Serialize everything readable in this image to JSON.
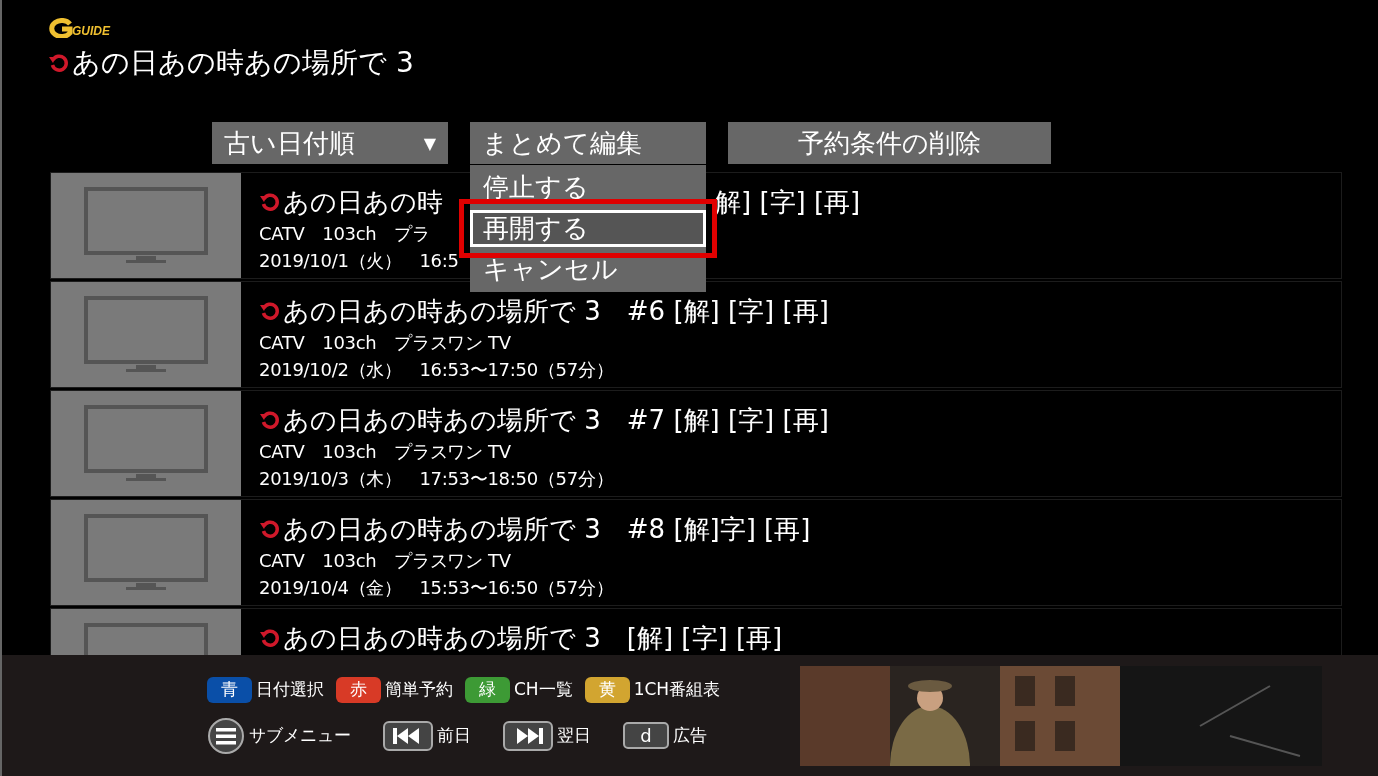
{
  "logo": {
    "text": "GUIDE"
  },
  "title": "あの日あの時あの場所で 3",
  "toolbar": {
    "sort": {
      "label": "古い日付順",
      "arrow": "▼"
    },
    "edit": {
      "label": "まとめて編集"
    },
    "delete": {
      "label": "予約条件の削除"
    }
  },
  "edit_menu": [
    {
      "label": "停止する",
      "selected": false
    },
    {
      "label": "再開する",
      "selected": true
    },
    {
      "label": "キャンセル",
      "selected": false
    }
  ],
  "programs": [
    {
      "title": "あの日あの時",
      "tail": "解] [字] [再]",
      "channel": "CATV　103ch　プラ",
      "time": "2019/10/1（火）　16:5"
    },
    {
      "title": "あの日あの時あの場所で 3　#6 [解] [字] [再]",
      "channel": "CATV　103ch　プラスワン TV",
      "time": "2019/10/2（水）　16:53〜17:50（57分）"
    },
    {
      "title": "あの日あの時あの場所で 3　#7 [解] [字] [再]",
      "channel": "CATV　103ch　プラスワン TV",
      "time": "2019/10/3（木）　17:53〜18:50（57分）"
    },
    {
      "title": "あの日あの時あの場所で 3　#8 [解]字] [再]",
      "channel": "CATV　103ch　プラスワン TV",
      "time": "2019/10/4（金）　15:53〜16:50（57分）"
    },
    {
      "title": "あの日あの時あの場所で 3　[解] [字] [再]"
    }
  ],
  "legend": [
    {
      "kind": "color",
      "key": "青",
      "label": "日付選択",
      "color": "#0a4fa8"
    },
    {
      "kind": "color",
      "key": "赤",
      "label": "簡単予約",
      "color": "#d83a26"
    },
    {
      "kind": "color",
      "key": "緑",
      "label": "CH一覧",
      "color": "#3d9a35"
    },
    {
      "kind": "color",
      "key": "黄",
      "label": "1CH番組表",
      "color": "#d2a530"
    }
  ],
  "controls": [
    {
      "kind": "menu",
      "label": "サブメニュー"
    },
    {
      "kind": "prev",
      "label": "前日"
    },
    {
      "kind": "next",
      "label": "翌日"
    },
    {
      "kind": "key",
      "key": "d",
      "label": "広告"
    }
  ]
}
